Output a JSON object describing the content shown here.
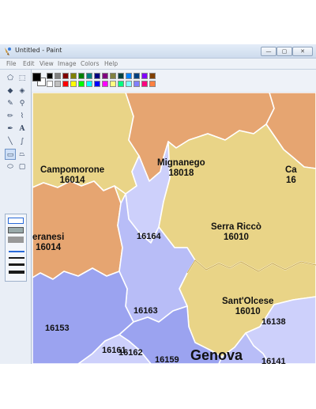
{
  "window": {
    "title": "Untitled - Paint",
    "minimize_glyph": "—",
    "maximize_glyph": "▢",
    "close_glyph": "✕"
  },
  "menu": [
    "File",
    "Edit",
    "View",
    "Image",
    "Colors",
    "Help"
  ],
  "palette_colors": [
    "#000000",
    "#808080",
    "#800000",
    "#808000",
    "#008000",
    "#008080",
    "#000080",
    "#800080",
    "#808040",
    "#004040",
    "#0080ff",
    "#004080",
    "#8000ff",
    "#804000",
    "#ffffff",
    "#c0c0c0",
    "#ff0000",
    "#ffff00",
    "#00ff00",
    "#00ffff",
    "#0000ff",
    "#ff00ff",
    "#ffff80",
    "#00ff80",
    "#80ffff",
    "#8080ff",
    "#ff0080",
    "#ff8040"
  ],
  "tools": [
    "free-select-icon",
    "rect-select-icon",
    "eraser-icon",
    "fill-icon",
    "color-picker-icon",
    "magnifier-icon",
    "pencil-icon",
    "brush-icon",
    "airbrush-icon",
    "text-icon",
    "line-icon",
    "curve-icon",
    "rectangle-icon",
    "polygon-icon",
    "ellipse-icon",
    "rounded-rect-icon"
  ],
  "map": {
    "colors": {
      "orange": "#e6a571",
      "yellow": "#e9d487",
      "light_blue": "#cdd0fb",
      "mid_blue": "#b8bdf7",
      "blue": "#9ba3f0",
      "border": "#ffffff"
    },
    "regions": [
      {
        "name": "Campomorone",
        "code": "16014"
      },
      {
        "name": "Mignanego",
        "code": "18018"
      },
      {
        "name": "Ca",
        "code": "16"
      },
      {
        "name": "eranesi",
        "code": "16014"
      },
      {
        "name": "",
        "code": "16164"
      },
      {
        "name": "Serra Riccò",
        "code": "16010"
      },
      {
        "name": "Sant'Olcese",
        "code": "16010"
      },
      {
        "name": "",
        "code": "16163"
      },
      {
        "name": "",
        "code": "16162"
      },
      {
        "name": "",
        "code": "16138"
      },
      {
        "name": "",
        "code": "16153"
      },
      {
        "name": "",
        "code": "16161"
      },
      {
        "name": "",
        "code": "16159"
      },
      {
        "name": "Genova",
        "code": ""
      },
      {
        "name": "",
        "code": "16141"
      }
    ]
  }
}
